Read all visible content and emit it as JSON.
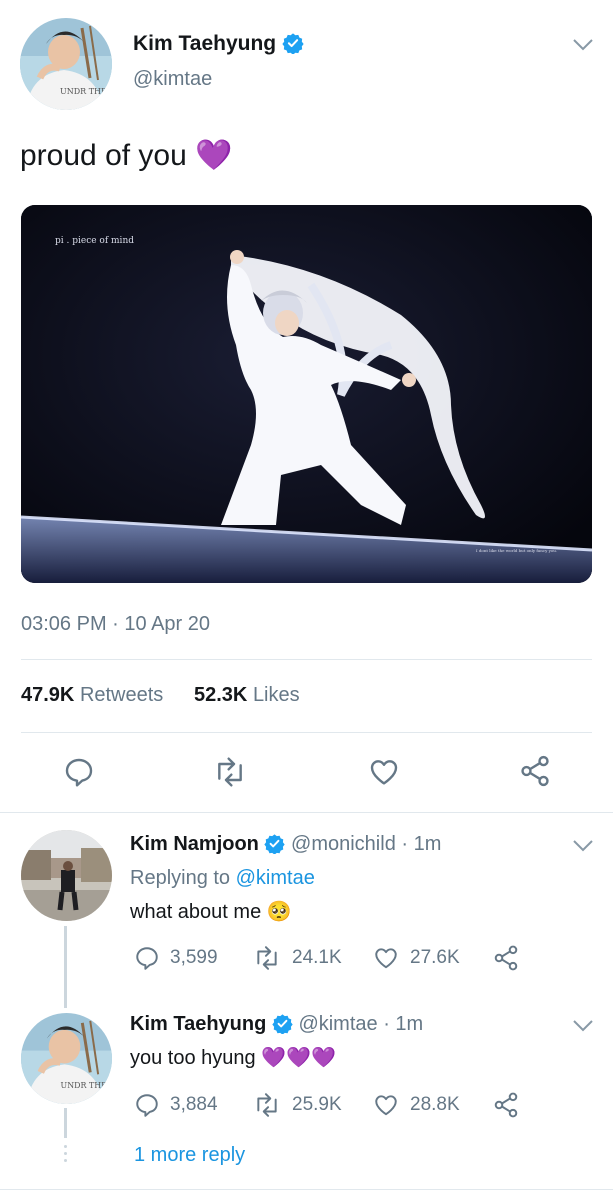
{
  "main_tweet": {
    "author_name": "Kim Taehyung",
    "handle": "@kimtae",
    "avatar_shirt_text": "UNDR THE",
    "text": "proud of you",
    "emoji": "💜",
    "media": {
      "watermark": "pi . piece of mind",
      "caption": "I dont like the world but only fancy you."
    },
    "timestamp": "03:06 PM · 10 Apr 20",
    "retweets_count": "47.9K",
    "retweets_label": "Retweets",
    "likes_count": "52.3K",
    "likes_label": "Likes"
  },
  "replies": [
    {
      "author_name": "Kim Namjoon",
      "handle": "@monichild",
      "time": "· 1m",
      "replying_prefix": "Replying to",
      "replying_handle": "@kimtae",
      "text": "what about me",
      "emoji": "🥺",
      "reply_count": "3,599",
      "retweet_count": "24.1K",
      "like_count": "27.6K"
    },
    {
      "author_name": "Kim Taehyung",
      "handle": "@kimtae",
      "time": "· 1m",
      "text": "you too hyung",
      "emoji": "💜💜💜",
      "reply_count": "3,884",
      "retweet_count": "25.9K",
      "like_count": "28.8K"
    }
  ],
  "more_replies_label": "1 more reply",
  "colors": {
    "accent": "#1b95e0",
    "muted": "#657786",
    "border": "#e1e8ed",
    "verified": "#1da1f2",
    "heart_purple": "#8a2be2"
  },
  "icons": [
    "chevron-down-icon",
    "verified-badge-icon",
    "reply-icon",
    "retweet-icon",
    "like-icon",
    "share-icon"
  ]
}
